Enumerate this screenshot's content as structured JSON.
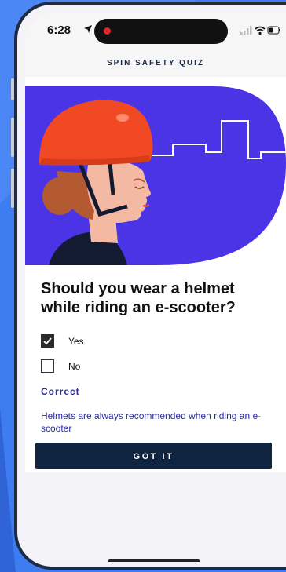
{
  "status_bar": {
    "time": "6:28",
    "location_icon": "location-arrow-icon",
    "signal_icon": "cellular-signal-icon",
    "wifi_icon": "wifi-icon",
    "battery_icon": "battery-icon"
  },
  "header": {
    "title": "SPIN SAFETY QUIZ"
  },
  "hero": {
    "illustration": "helmet-rider-illustration",
    "colors": {
      "background": "#4a34e6",
      "helmet": "#f04923",
      "skin": "#f4b9a3",
      "hair": "#b45a33",
      "jacket": "#131b33"
    }
  },
  "quiz": {
    "question": "Should you wear a helmet while riding an e-scooter?",
    "options": [
      {
        "label": "Yes",
        "checked": true
      },
      {
        "label": "No",
        "checked": false
      }
    ],
    "result_title": "Correct",
    "result_text": "Helmets are always recommended when riding an e-scooter",
    "button_label": "GOT IT"
  },
  "colors": {
    "accent": "#2d2aa5",
    "button": "#0f2440",
    "page_background": "#3e7cf2"
  }
}
